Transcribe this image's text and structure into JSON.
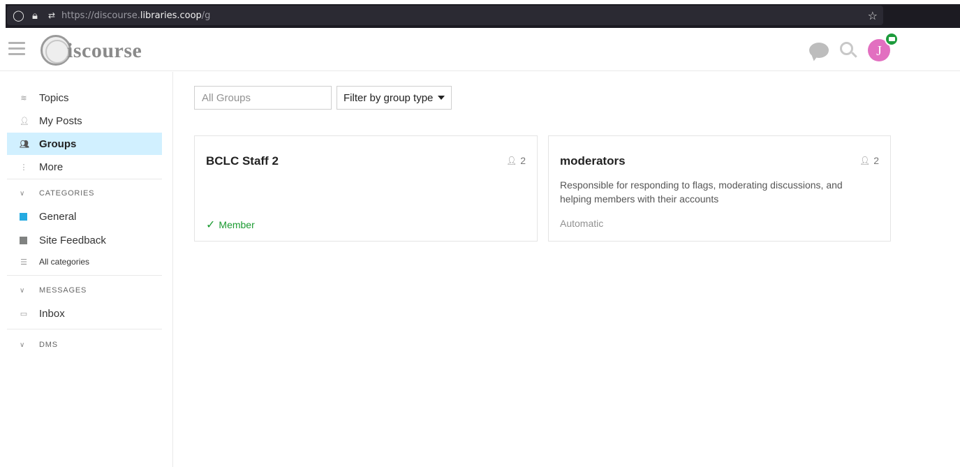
{
  "browser": {
    "url_prefix": "https://discourse.",
    "url_domain": "libraries.coop",
    "url_path": "/g"
  },
  "header": {
    "logo_text": "iscourse",
    "avatar_letter": "J"
  },
  "sidebar": {
    "items": [
      {
        "label": "Topics",
        "icon": "layers-icon"
      },
      {
        "label": "My Posts",
        "icon": "user-icon"
      },
      {
        "label": "Groups",
        "icon": "users-icon"
      },
      {
        "label": "More",
        "icon": "ellipsis-icon"
      }
    ],
    "categories": {
      "heading": "CATEGORIES",
      "items": [
        {
          "label": "General",
          "color": "#25aae1"
        },
        {
          "label": "Site Feedback",
          "color": "#808281"
        }
      ],
      "all_label": "All categories"
    },
    "messages": {
      "heading": "MESSAGES",
      "inbox_label": "Inbox"
    },
    "dms": {
      "heading": "DMS"
    }
  },
  "filters": {
    "search_placeholder": "All Groups",
    "type_filter_label": "Filter by group type"
  },
  "groups": [
    {
      "name": "BCLC Staff 2",
      "member_count": "2",
      "description": "",
      "status": "Member"
    },
    {
      "name": "moderators",
      "member_count": "2",
      "description": "Responsible for responding to flags, moderating discussions, and helping members with their accounts",
      "status": "Automatic"
    }
  ],
  "colors": {
    "accent": "#d1f0ff",
    "member_green": "#1a9a30",
    "avatar_pink": "#e26fc0"
  }
}
